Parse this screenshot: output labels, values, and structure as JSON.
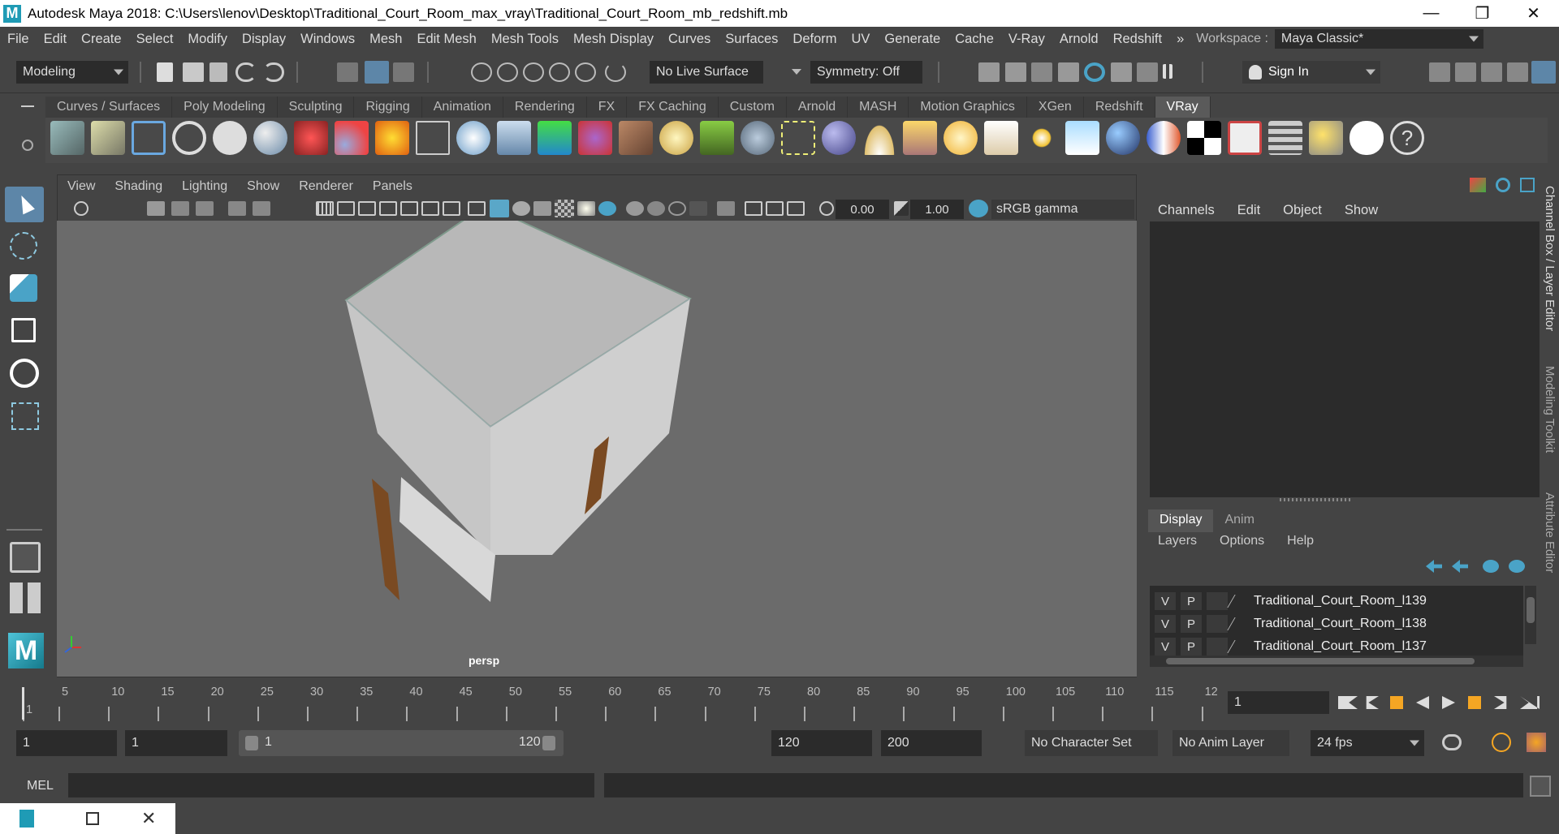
{
  "window": {
    "title": "Autodesk Maya 2018: C:\\Users\\lenov\\Desktop\\Traditional_Court_Room_max_vray\\Traditional_Court_Room_mb_redshift.mb",
    "app_icon_glyph": "M",
    "minimize_glyph": "—",
    "maximize_glyph": "❐",
    "close_glyph": "✕"
  },
  "menubar": {
    "items": [
      "File",
      "Edit",
      "Create",
      "Select",
      "Modify",
      "Display",
      "Windows",
      "Mesh",
      "Edit Mesh",
      "Mesh Tools",
      "Mesh Display",
      "Curves",
      "Surfaces",
      "Deform",
      "UV",
      "Generate",
      "Cache",
      "V-Ray",
      "Arnold",
      "Redshift"
    ],
    "overflow": "»",
    "workspace_label": "Workspace :",
    "workspace_value": "Maya Classic*"
  },
  "statusline": {
    "mode": "Modeling",
    "live_surface": "No Live Surface",
    "symmetry": "Symmetry: Off",
    "sign_in": "Sign In"
  },
  "shelf": {
    "tabs": [
      "Curves / Surfaces",
      "Poly Modeling",
      "Sculpting",
      "Rigging",
      "Animation",
      "Rendering",
      "FX",
      "FX Caching",
      "Custom",
      "Arnold",
      "MASH",
      "Motion Graphics",
      "XGen",
      "Redshift",
      "VRay"
    ],
    "active_tab": "VRay"
  },
  "viewport": {
    "menu": [
      "View",
      "Shading",
      "Lighting",
      "Show",
      "Renderer",
      "Panels"
    ],
    "exposure": "0.00",
    "gamma": "1.00",
    "color_space": "sRGB gamma",
    "camera_label": "persp"
  },
  "channel_box": {
    "menu": [
      "Channels",
      "Edit",
      "Object",
      "Show"
    ],
    "side_tabs": [
      "Channel Box / Layer Editor",
      "Modeling Toolkit",
      "Attribute Editor"
    ]
  },
  "layer_editor": {
    "tabs": [
      "Display",
      "Anim"
    ],
    "active_tab": "Display",
    "menu": [
      "Layers",
      "Options",
      "Help"
    ],
    "layers": [
      {
        "v": "V",
        "p": "P",
        "name": "Traditional_Court_Room_l139"
      },
      {
        "v": "V",
        "p": "P",
        "name": "Traditional_Court_Room_l138"
      },
      {
        "v": "V",
        "p": "P",
        "name": "Traditional_Court_Room_l137"
      }
    ]
  },
  "timeline": {
    "labels": [
      "1",
      "5",
      "10",
      "15",
      "20",
      "25",
      "30",
      "35",
      "40",
      "45",
      "50",
      "55",
      "60",
      "65",
      "70",
      "75",
      "80",
      "85",
      "90",
      "95",
      "100",
      "105",
      "110",
      "115",
      "12"
    ],
    "current_frame": "1"
  },
  "range": {
    "start": "1",
    "playback_start": "1",
    "slider_start": "1",
    "slider_end": "120",
    "playback_end": "120",
    "end": "200",
    "character_set": "No Character Set",
    "anim_layer": "No Anim Layer",
    "fps": "24 fps"
  },
  "command_line": {
    "language": "MEL"
  },
  "colors": {
    "accent_blue": "#5aa7c8",
    "selected_tool": "#5d86a8",
    "viewport_bg": "#6b6b6b",
    "building_top": "#b8b8b8",
    "door_brown": "#7a4a22"
  }
}
